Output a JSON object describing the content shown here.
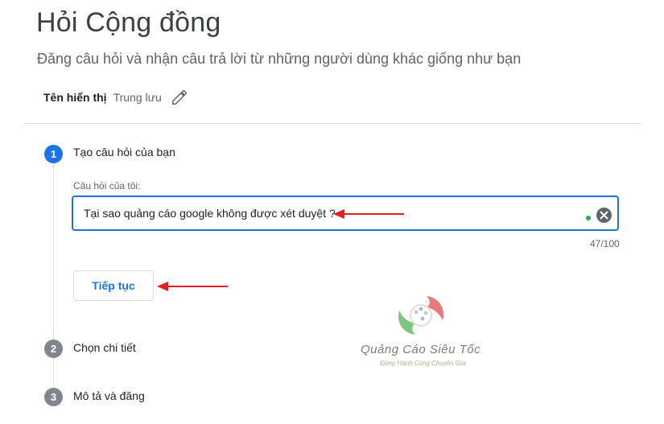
{
  "header": {
    "title": "Hỏi Cộng đồng",
    "subtitle": "Đăng câu hỏi và nhận câu trả lời từ những người dùng khác giống như bạn"
  },
  "display_name": {
    "label": "Tên hiển thị",
    "value": "Trung lưu",
    "edit_icon": "pencil-icon"
  },
  "steps": [
    {
      "number": "1",
      "label": "Tạo câu hỏi của bạn",
      "active": true
    },
    {
      "number": "2",
      "label": "Chọn chi tiết",
      "active": false
    },
    {
      "number": "3",
      "label": "Mô tả và đăng",
      "active": false
    }
  ],
  "question": {
    "field_label": "Câu hỏi của tôi:",
    "value": "Tại sao quảng cáo google không được xét duyệt ?",
    "counter": "47/100",
    "clear_icon": "close-circle-icon"
  },
  "continue_label": "Tiếp tục",
  "watermark": {
    "brand": "Quảng Cáo Siêu Tốc",
    "tagline": "Đồng Hành Cùng Chuyên Gia"
  },
  "colors": {
    "accent": "#1a73e8",
    "annotation_arrow": "#e02020",
    "step_inactive": "#80868b"
  }
}
